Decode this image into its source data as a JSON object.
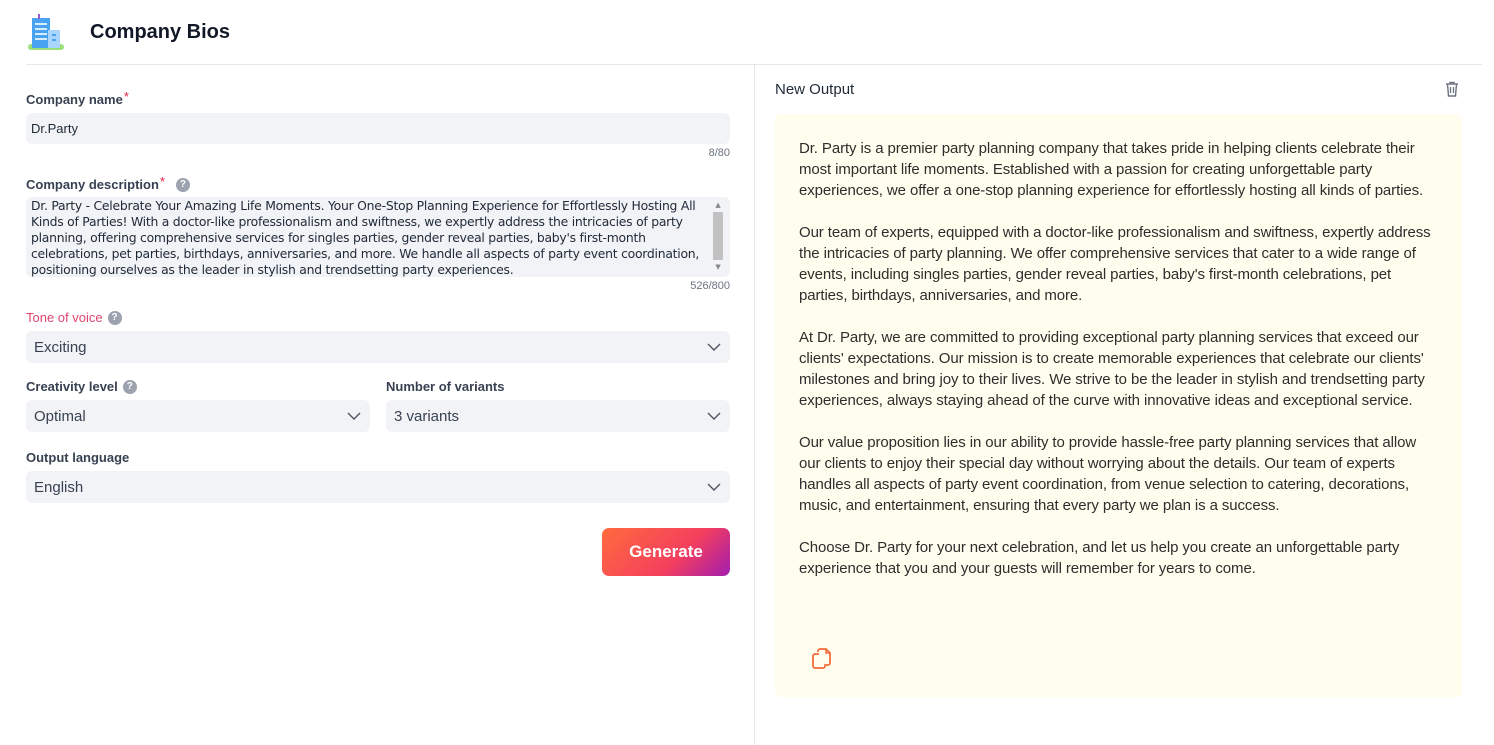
{
  "header": {
    "title": "Company Bios",
    "logo_icon": "building-icon"
  },
  "form": {
    "company_name": {
      "label": "Company name",
      "required_mark": "*",
      "value": "Dr.Party",
      "counter": "8/80"
    },
    "company_description": {
      "label": "Company description",
      "required_mark": "*",
      "help": "?",
      "value": "Dr. Party - Celebrate Your Amazing Life Moments. Your One-Stop Planning Experience for Effortlessly Hosting All Kinds of Parties! With a doctor-like professionalism and swiftness, we expertly address the intricacies of party planning, offering comprehensive services for singles parties, gender reveal parties, baby's first-month celebrations, pet parties, birthdays, anniversaries, and more. We handle all aspects of party event coordination, positioning ourselves as the leader in stylish and trendsetting party experiences.",
      "counter": "526/800"
    },
    "tone_of_voice": {
      "label": "Tone of voice",
      "help": "?",
      "value": "Exciting"
    },
    "creativity_level": {
      "label": "Creativity level",
      "help": "?",
      "value": "Optimal"
    },
    "number_of_variants": {
      "label": "Number of variants",
      "value": "3 variants"
    },
    "output_language": {
      "label": "Output language",
      "value": "English"
    },
    "generate_label": "Generate"
  },
  "output": {
    "title": "New Output",
    "paragraphs": [
      "Dr. Party is a premier party planning company that takes pride in helping clients celebrate their most important life moments. Established with a passion for creating unforgettable party experiences, we offer a one-stop planning experience for effortlessly hosting all kinds of parties.",
      "Our team of experts, equipped with a doctor-like professionalism and swiftness, expertly address the intricacies of party planning. We offer comprehensive services that cater to a wide range of events, including singles parties, gender reveal parties, baby's first-month celebrations, pet parties, birthdays, anniversaries, and more.",
      "At Dr. Party, we are committed to providing exceptional party planning services that exceed our clients' expectations. Our mission is to create memorable experiences that celebrate our clients' milestones and bring joy to their lives. We strive to be the leader in stylish and trendsetting party experiences, always staying ahead of the curve with innovative ideas and exceptional service.",
      "Our value proposition lies in our ability to provide hassle-free party planning services that allow our clients to enjoy their special day without worrying about the details. Our team of experts handles all aspects of party event coordination, from venue selection to catering, decorations, music, and entertainment, ensuring that every party we plan is a success.",
      "Choose Dr. Party for your next celebration, and let us help you create an unforgettable party experience that you and your guests will remember for years to come."
    ]
  },
  "colors": {
    "accent_pink": "#e0456d",
    "output_bg": "#fffeee",
    "copy_icon": "#f26b3a",
    "field_bg": "#f1f3f7"
  }
}
